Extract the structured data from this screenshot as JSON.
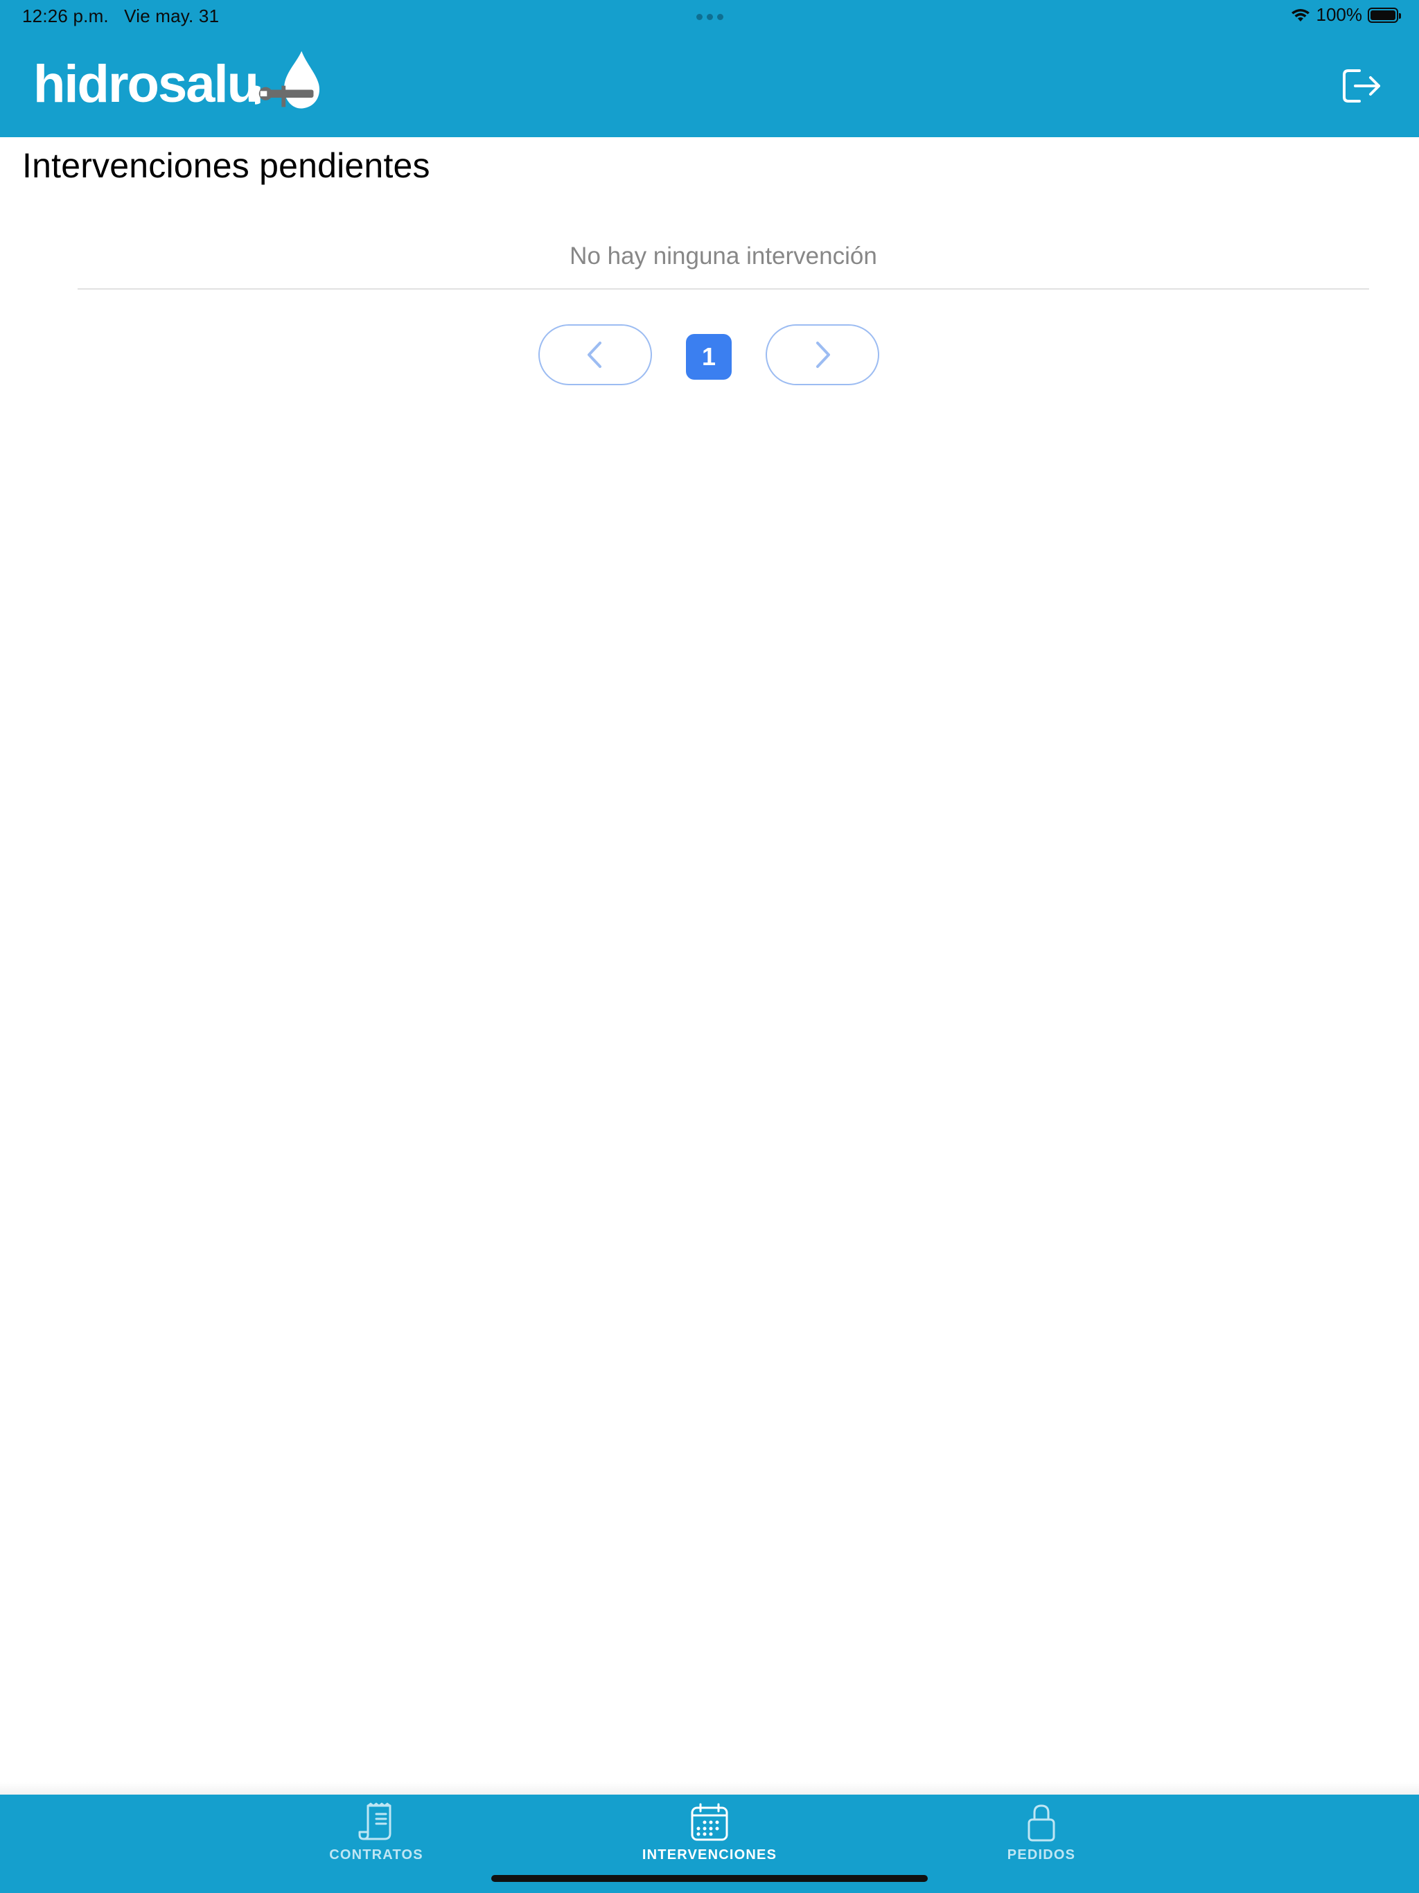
{
  "status_bar": {
    "time": "12:26 p.m.",
    "date": "Vie may. 31",
    "battery": "100%",
    "battery_level": 1.0
  },
  "header": {
    "logo_text": "hidrosalu",
    "logout_icon": "logout-icon",
    "background_color": "#159fcd"
  },
  "main": {
    "title": "Intervenciones pendientes",
    "empty_message": "No hay ninguna intervención"
  },
  "pagination": {
    "current_page": "1",
    "prev_icon": "chevron-left-icon",
    "next_icon": "chevron-right-icon",
    "active_color": "#3b7ff0",
    "border_color": "#9cbcf2"
  },
  "tabs": [
    {
      "label": "CONTRATOS",
      "icon": "receipt-icon",
      "active": false
    },
    {
      "label": "INTERVENCIONES",
      "icon": "calendar-icon",
      "active": true
    },
    {
      "label": "PEDIDOS",
      "icon": "lock-icon",
      "active": false
    }
  ]
}
